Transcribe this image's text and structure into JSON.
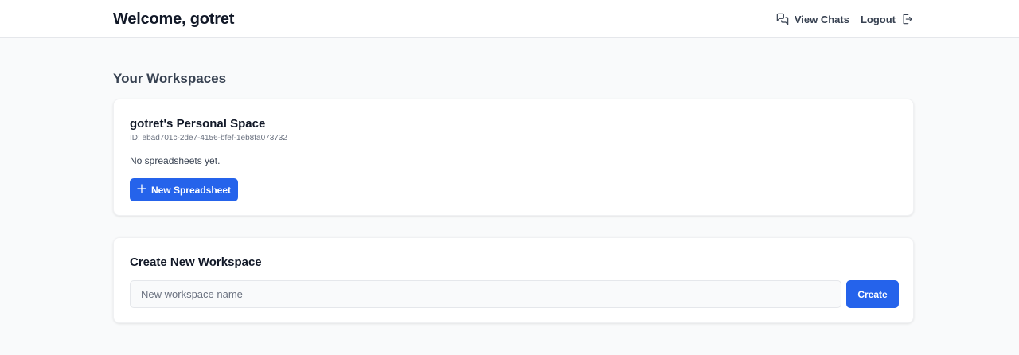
{
  "header": {
    "welcome": "Welcome, gotret",
    "view_chats_label": "View Chats",
    "view_chats_icon": "chat-bubbles-icon",
    "logout_label": "Logout",
    "logout_icon": "logout-icon"
  },
  "workspaces": {
    "title": "Your Workspaces",
    "items": [
      {
        "name": "gotret's Personal Space",
        "id_text": "ID: ebad701c-2de7-4156-bfef-1eb8fa073732",
        "empty_text": "No spreadsheets yet.",
        "new_sheet_label": "New Spreadsheet",
        "new_sheet_icon": "plus-icon"
      }
    ]
  },
  "create_workspace": {
    "title": "Create New Workspace",
    "input_value": "",
    "placeholder": "New workspace name",
    "button_label": "Create"
  },
  "colors": {
    "primary": "#2563eb",
    "background": "#f9fafb",
    "card": "#ffffff",
    "text": "#111827",
    "muted": "#6b7280"
  }
}
